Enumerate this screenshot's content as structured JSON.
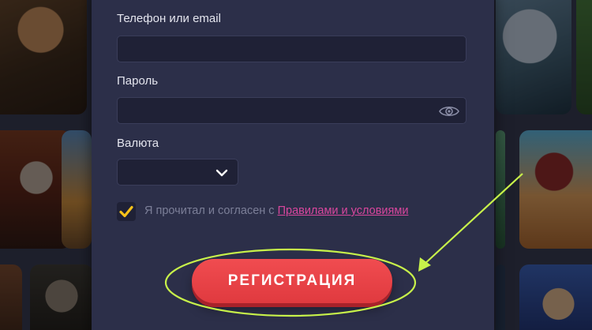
{
  "form": {
    "contact_label": "Телефон или email",
    "contact_value": "",
    "password_label": "Пароль",
    "password_value": "",
    "currency_label": "Валюта",
    "currency_value": "",
    "terms_prefix": "Я прочитал и согласен с ",
    "terms_link": "Правилами и условиями",
    "terms_checked": true,
    "register_label": "РЕГИСТРАЦИЯ"
  },
  "icons": {
    "password_toggle": "eye-icon",
    "currency_dropdown": "chevron-down-icon",
    "checkbox_mark": "checkmark-icon"
  },
  "colors": {
    "panel_bg": "#2c2f49",
    "field_bg": "#1f2136",
    "checkbox_mark": "#f6c21a",
    "link": "#d9469d",
    "button": "#e8434a",
    "annotation": "#c8f24a"
  }
}
